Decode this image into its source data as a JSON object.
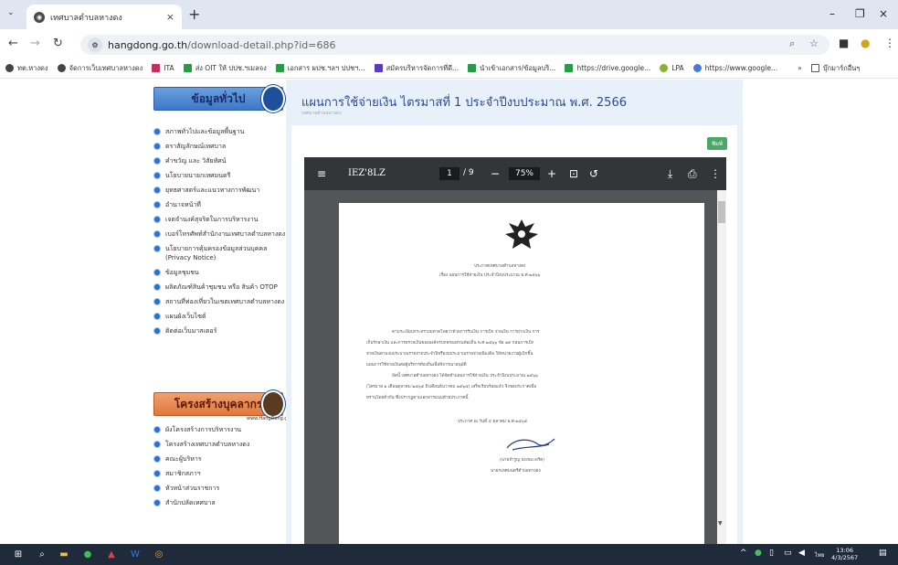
{
  "tab": {
    "title": "เทศบาลตำบลหางดง",
    "close": "×",
    "new": "+",
    "menu": "⌄"
  },
  "window": {
    "min": "–",
    "restore": "❐",
    "close": "×"
  },
  "address": {
    "domain": "hangdong.go.th",
    "path": "/download-detail.php?id=686"
  },
  "bookmarks": [
    {
      "label": "ทต.หางดง",
      "color": "#444"
    },
    {
      "label": "จัดการเว็บเทศบาลหางดง",
      "color": "#444"
    },
    {
      "label": "ITA",
      "color": "#c03060"
    },
    {
      "label": "ส่ง OIT ให้ ปปช.ฯเมลจง",
      "color": "#2a9a4a"
    },
    {
      "label": "เอกสาร ผปช.ฯลฯ ปปชฯ...",
      "color": "#2a9a4a"
    },
    {
      "label": "สมัครบริหารจัดการที่ดี...",
      "color": "#5a3ac0"
    },
    {
      "label": "นำเข้าเอกสาร/ข้อมูลบริ...",
      "color": "#2a9a4a"
    },
    {
      "label": "https://drive.google...",
      "color": "#2a9a4a"
    },
    {
      "label": "LPA",
      "color": "#8ab030"
    },
    {
      "label": "https://www.google...",
      "color": "#4a7ad8"
    }
  ],
  "bookmarks_more": "»",
  "bookmarks_folder": "บุ๊กมาร์กอื่นๆ",
  "sidebar": {
    "section1": "ข้อมูลทั่วไป",
    "section1_items": [
      "สภาพทั่วไปและข้อมูลพื้นฐาน",
      "ตราสัญลักษณ์เทศบาล",
      "คำขวัญ และ วิสัยทัศน์",
      "นโยบายนายกเทศมนตรี",
      "ยุทธศาสตร์และแนวทางการพัฒนา",
      "อำนาจหน้าที่",
      "เจตจำนงค์สุจริตในการบริหารงาน",
      "เบอร์โทรศัพท์สำนักงานเทศบาลตำบลหางดง",
      "นโยบายการคุ้มครองข้อมูลส่วนบุคคล (Privacy Notice)",
      "ข้อมูลชุมชน",
      "ผลิตภัณฑ์สินค้าชุมชน หรือ สินค้า OTOP",
      "สถานที่ท่องเที่ยวในเขตเทศบาลตำบลหางดง",
      "แผนผังเว็บไซต์",
      "ติดต่อเว็บมาสเตอร์"
    ],
    "section2": "โครงสร้างบุคลากร",
    "section2_note": "www.HangDong.go.th",
    "section2_items": [
      "ผังโครงสร้างการบริหารงาน",
      "โครงสร้างเทศบาลตำบลหางดง",
      "คณะผู้บริหาร",
      "สมาชิกสภาฯ",
      "หัวหน้าส่วนราชการ",
      "สำนักปลัดเทศบาล"
    ]
  },
  "content": {
    "title": "แผนการใช้จ่ายเงิน ไตรมาสที่ 1 ประจำปีงบประมาณ พ.ศ. 2566",
    "subtitle": "เทศบาลตำบลหางดง",
    "print_label": "พิมพ์"
  },
  "pdf": {
    "filename": "IEZ'8LZ",
    "page": "1",
    "of": "/ 9",
    "zoom": "75%",
    "lines": [
      "ประกาศเทศบาลตำบลหางดง",
      "เรื่อง แผนการใช้จ่ายเงิน ประจำปีงบประมาณ พ.ศ.๒๕๖๖",
      "ตามระเบียบกระทรวงมหาดไทยว่าด้วยการรับเงิน การเบิก จ่ายเงิน การฝากเงิน การ",
      "เก็บรักษาเงิน และการตรวจเงินขององค์กรปกครองส่วนท้องถิ่น พ.ศ.๒๕๖๖ ข้อ ๑๙ ก่อนการเบิก",
      "จ่ายเงินตามงบประมาณรายจ่ายประจำปีหรืองบประมาณรายจ่ายเพิ่มเติม ให้หน่วยงานผู้เบิกขึ้น",
      "แผนการใช้จ่ายเงินต่อผู้บริหารท้องถิ่นเพื่อพิจารณาอนุมัติ",
      "บัดนี้ เทศบาลตำบลหางดง ได้จัดทำแผนการใช้จ่ายเงิน ประจำปีงบประมาณ ๒๕๖๖",
      "(ไตรมาส ๑ เดือนตุลาคม ๒๕๖๕ ถึงเดือนธันวาคม ๒๕๖๕) เสร็จเรียบร้อยแล้ว จึงขอประกาศเพื่อ",
      "ทราบโดยทั่วกัน ซึ่งปรากฏตามเอกสารแนบท้ายประกาศนี้",
      "ประกาศ ณ วันที่ ๔ ตุลาคม พ.ศ.๒๕๖๕",
      "(นายจำรูญ ปงเขมะพริต)",
      "นายกเทศมนตรีตำบลหางดง"
    ]
  },
  "taskbar": {
    "lang": "ไทย",
    "time": "13:06",
    "date": "4/3/2567"
  }
}
